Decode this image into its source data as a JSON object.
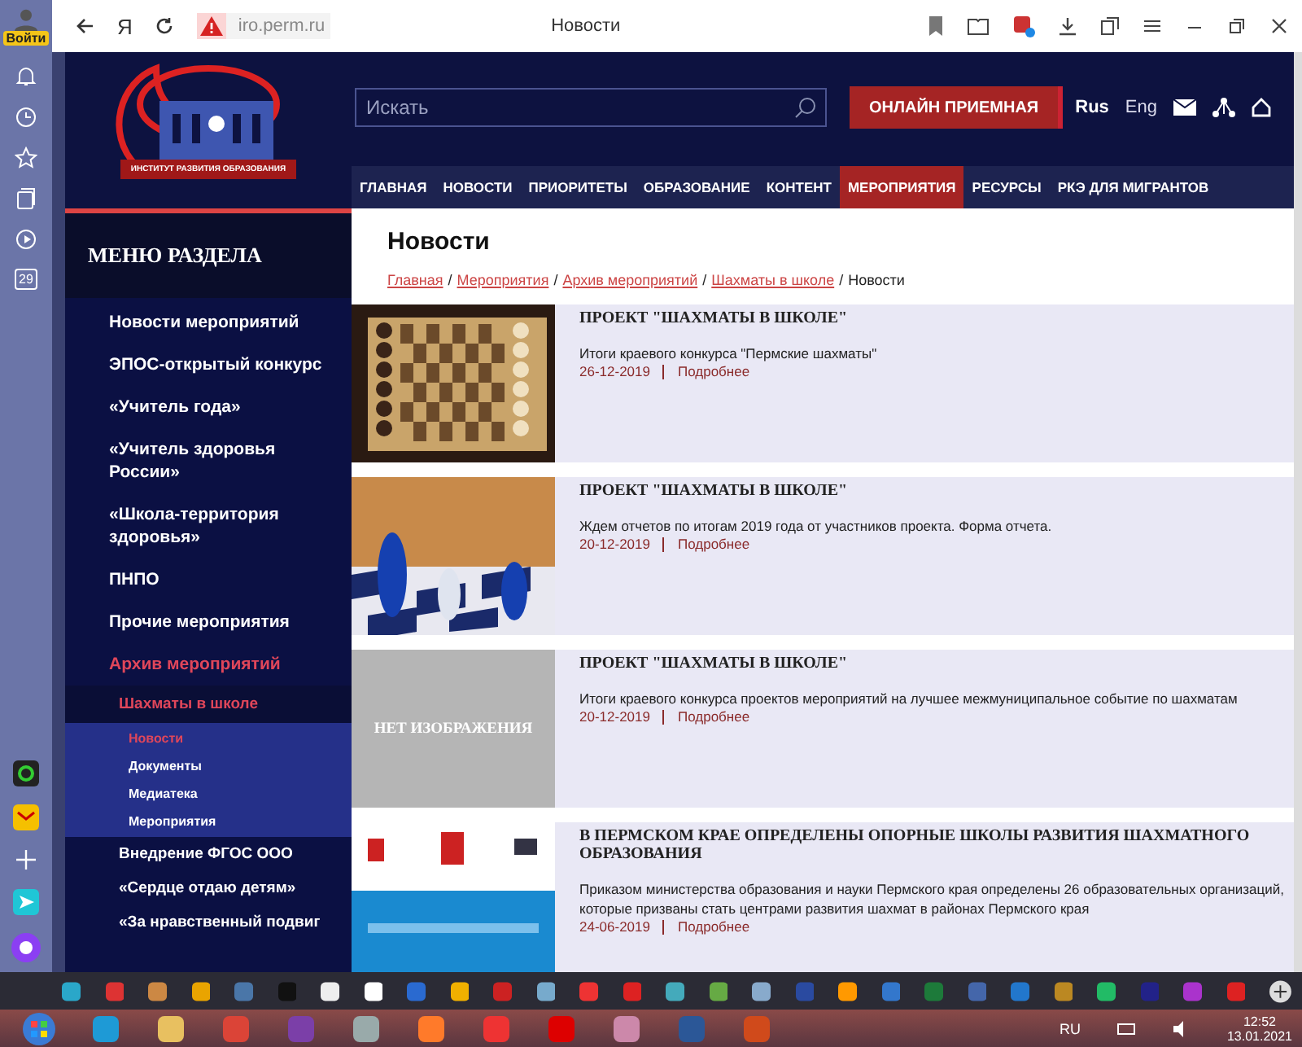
{
  "browser": {
    "profile_label": "Войти",
    "yandex_label": "Я",
    "url": "iro.perm.ru",
    "title": "Новости",
    "counter": "29"
  },
  "header": {
    "logo_caption": "ИНСТИТУТ РАЗВИТИЯ ОБРАЗОВАНИЯ",
    "search": {
      "placeholder": "Искать"
    },
    "reception_button": "ОНЛАЙН ПРИЕМНАЯ",
    "languages": [
      {
        "label": "Rus",
        "selected": true
      },
      {
        "label": "Eng",
        "selected": false
      }
    ]
  },
  "nav": [
    {
      "label": "ГЛАВНАЯ",
      "selected": false
    },
    {
      "label": "НОВОСТИ",
      "selected": false
    },
    {
      "label": "ПРИОРИТЕТЫ",
      "selected": false
    },
    {
      "label": "ОБРАЗОВАНИЕ",
      "selected": false
    },
    {
      "label": "КОНТЕНТ",
      "selected": false
    },
    {
      "label": "МЕРОПРИЯТИЯ",
      "selected": true
    },
    {
      "label": "РЕСУРСЫ",
      "selected": false
    },
    {
      "label": "РКЭ ДЛЯ МИГРАНТОВ",
      "selected": false
    }
  ],
  "sidebar": {
    "title": "МЕНЮ РАЗДЕЛА",
    "items": [
      {
        "label": "Новости мероприятий",
        "selected": false
      },
      {
        "label": "ЭПОС-открытый конкурс",
        "selected": false
      },
      {
        "label": "«Учитель года»",
        "selected": false
      },
      {
        "label": "«Учитель здоровья России»",
        "selected": false
      },
      {
        "label": "«Школа-территория здоровья»",
        "selected": false
      },
      {
        "label": "ПНПО",
        "selected": false
      },
      {
        "label": "Прочие мероприятия",
        "selected": false
      },
      {
        "label": "Архив мероприятий",
        "selected": true,
        "children": [
          {
            "label": "Шахматы в школе",
            "selected": true,
            "children": [
              {
                "label": "Новости",
                "selected": true
              },
              {
                "label": "Документы",
                "selected": false
              },
              {
                "label": "Медиатека",
                "selected": false
              },
              {
                "label": "Мероприятия",
                "selected": false
              }
            ]
          },
          {
            "label": "Внедрение ФГОС ООО",
            "selected": false
          },
          {
            "label": "«Сердце отдаю детям»",
            "selected": false
          },
          {
            "label": "«За нравственный подвиг",
            "selected": false
          }
        ]
      }
    ]
  },
  "content": {
    "title": "Новости",
    "breadcrumbs": [
      {
        "label": "Главная",
        "kind": "link"
      },
      {
        "label": "/",
        "kind": "separator"
      },
      {
        "label": "Мероприятия",
        "kind": "link"
      },
      {
        "label": "/",
        "kind": "separator"
      },
      {
        "label": "Архив мероприятий",
        "kind": "link"
      },
      {
        "label": "/",
        "kind": "separator"
      },
      {
        "label": "Шахматы в школе",
        "kind": "link"
      },
      {
        "label": "/",
        "kind": "separator"
      },
      {
        "label": "Новости",
        "kind": "current"
      }
    ],
    "news": [
      {
        "title": "ПРОЕКТ \"ШАХМАТЫ В ШКОЛЕ\"",
        "summary": "Итоги краевого конкурса \"Пермские шахматы\"",
        "date": "26-12-2019",
        "more": "Подробнее"
      },
      {
        "title": "ПРОЕКТ \"ШАХМАТЫ В ШКОЛЕ\"",
        "summary": "Ждем отчетов по итогам 2019 года от участников проекта. Форма отчета.",
        "date": "20-12-2019",
        "more": "Подробнее"
      },
      {
        "image": {
          "kind": "placeholder",
          "text": "НЕТ ИЗОБРАЖЕНИЯ"
        },
        "title": "ПРОЕКТ \"ШАХМАТЫ В ШКОЛЕ\"",
        "summary": "Итоги краевого конкурса проектов мероприятий на лучшее межмуниципальное событие по шахматам",
        "date": "20-12-2019",
        "more": "Подробнее"
      },
      {
        "title": "В ПЕРМСКОМ КРАЕ ОПРЕДЕЛЕНЫ ОПОРНЫЕ ШКОЛЫ РАЗВИТИЯ ШАХМАТНОГО ОБРАЗОВАНИЯ",
        "summary": "Приказом министерства образования и науки Пермского края определены 26 образовательных организаций, которые призваны стать центрами развития шахмат в районах Пермского края",
        "date": "24-06-2019",
        "more": "Подробнее"
      }
    ]
  },
  "tray": {
    "language": "RU",
    "time": "12:52",
    "date": "13.01.2021"
  }
}
